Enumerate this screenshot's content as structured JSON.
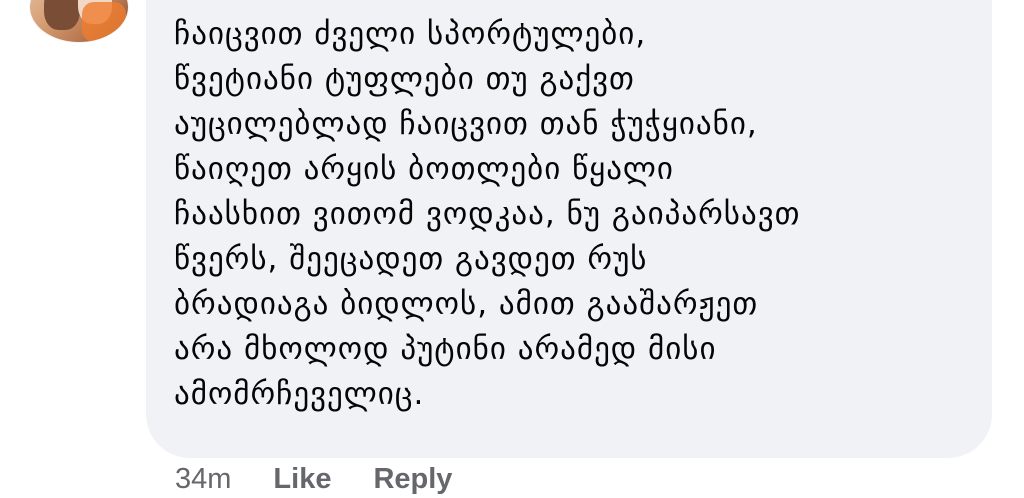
{
  "comment": {
    "lines": [
      "ჩაიცვით ძველი სპორტულები,",
      "წვეტიანი ტუფლები თუ გაქვთ",
      "აუცილებლად ჩაიცვით თან ჭუჭყიანი,",
      "წაიღეთ არყის ბოთლები წყალი",
      "ჩაასხით ვითომ ვოდკაა, ნუ გაიპარსავთ",
      "წვერს, შეეცადეთ გავდეთ რუს",
      "ბრადიაგა ბიდლოს, ამით გააშარჟეთ",
      "არა მხოლოდ პუტინი არამედ მისი",
      "ამომრჩეველიც."
    ]
  },
  "actions": {
    "time": "34m",
    "like_label": "Like",
    "reply_label": "Reply"
  },
  "colors": {
    "bubble_bg": "#f0f2f5",
    "text": "#050505",
    "meta": "#65676b"
  }
}
